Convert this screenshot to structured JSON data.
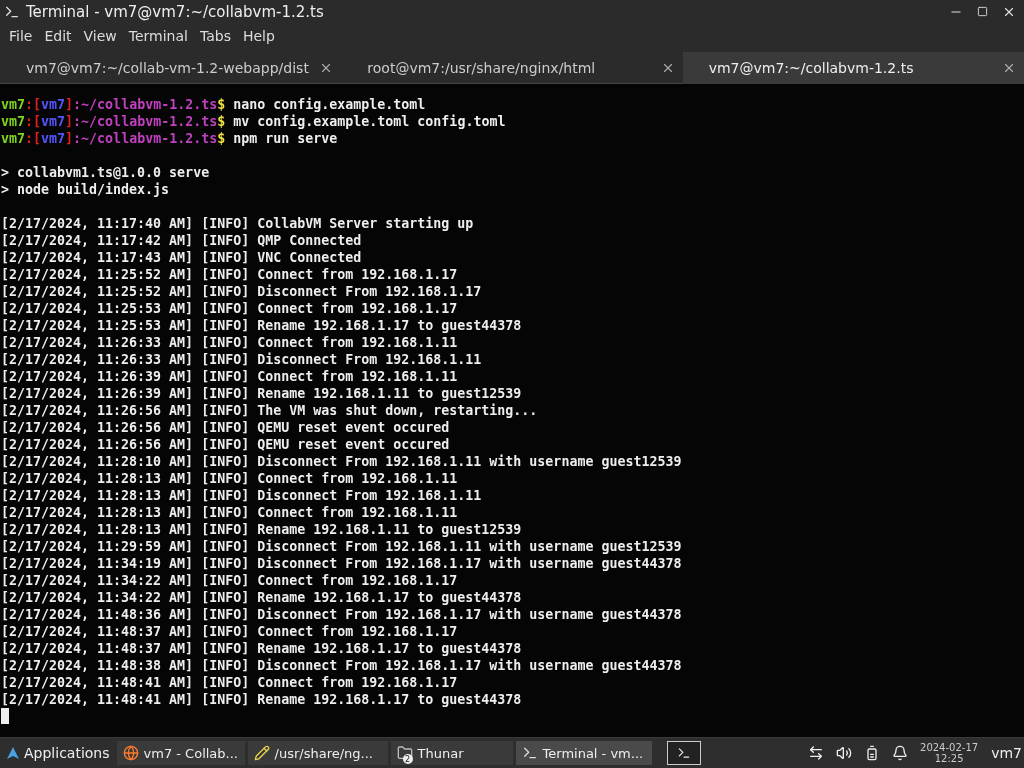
{
  "window": {
    "title": "Terminal - vm7@vm7:~/collabvm-1.2.ts"
  },
  "menu": [
    "File",
    "Edit",
    "View",
    "Terminal",
    "Tabs",
    "Help"
  ],
  "tabs": [
    {
      "label": "vm7@vm7:~/collab-vm-1.2-webapp/dist",
      "selected": false
    },
    {
      "label": "root@vm7:/usr/share/nginx/html",
      "selected": false
    },
    {
      "label": "vm7@vm7:~/collabvm-1.2.ts",
      "selected": true
    }
  ],
  "terminal": {
    "prompts": [
      {
        "segments": [
          {
            "text": "vm7",
            "color": "#7fd321"
          },
          {
            "text": ":[",
            "color": "#e02020"
          },
          {
            "text": "vm7",
            "color": "#5555ff"
          },
          {
            "text": "]",
            "color": "#e02020"
          },
          {
            "text": ":~/collabvm-1.2.ts",
            "color": "#c040c0"
          },
          {
            "text": "$",
            "color": "#f0e040"
          },
          {
            "text": " nano config.example.toml",
            "color": "#eeeeee"
          }
        ]
      },
      {
        "segments": [
          {
            "text": "vm7",
            "color": "#7fd321"
          },
          {
            "text": ":[",
            "color": "#e02020"
          },
          {
            "text": "vm7",
            "color": "#5555ff"
          },
          {
            "text": "]",
            "color": "#e02020"
          },
          {
            "text": ":~/collabvm-1.2.ts",
            "color": "#c040c0"
          },
          {
            "text": "$",
            "color": "#f0e040"
          },
          {
            "text": " mv config.example.toml config.toml",
            "color": "#eeeeee"
          }
        ]
      },
      {
        "segments": [
          {
            "text": "vm7",
            "color": "#7fd321"
          },
          {
            "text": ":[",
            "color": "#e02020"
          },
          {
            "text": "vm7",
            "color": "#5555ff"
          },
          {
            "text": "]",
            "color": "#e02020"
          },
          {
            "text": ":~/collabvm-1.2.ts",
            "color": "#c040c0"
          },
          {
            "text": "$",
            "color": "#f0e040"
          },
          {
            "text": " npm run serve",
            "color": "#eeeeee"
          }
        ]
      }
    ],
    "npm_output": [
      "> collabvm1.ts@1.0.0 serve",
      "> node build/index.js"
    ],
    "log": [
      "[2/17/2024, 11:17:40 AM] [INFO] CollabVM Server starting up",
      "[2/17/2024, 11:17:42 AM] [INFO] QMP Connected",
      "[2/17/2024, 11:17:43 AM] [INFO] VNC Connected",
      "[2/17/2024, 11:25:52 AM] [INFO] Connect from 192.168.1.17",
      "[2/17/2024, 11:25:52 AM] [INFO] Disconnect From 192.168.1.17",
      "[2/17/2024, 11:25:53 AM] [INFO] Connect from 192.168.1.17",
      "[2/17/2024, 11:25:53 AM] [INFO] Rename 192.168.1.17 to guest44378",
      "[2/17/2024, 11:26:33 AM] [INFO] Connect from 192.168.1.11",
      "[2/17/2024, 11:26:33 AM] [INFO] Disconnect From 192.168.1.11",
      "[2/17/2024, 11:26:39 AM] [INFO] Connect from 192.168.1.11",
      "[2/17/2024, 11:26:39 AM] [INFO] Rename 192.168.1.11 to guest12539",
      "[2/17/2024, 11:26:56 AM] [INFO] The VM was shut down, restarting...",
      "[2/17/2024, 11:26:56 AM] [INFO] QEMU reset event occured",
      "[2/17/2024, 11:26:56 AM] [INFO] QEMU reset event occured",
      "[2/17/2024, 11:28:10 AM] [INFO] Disconnect From 192.168.1.11 with username guest12539",
      "[2/17/2024, 11:28:13 AM] [INFO] Connect from 192.168.1.11",
      "[2/17/2024, 11:28:13 AM] [INFO] Disconnect From 192.168.1.11",
      "[2/17/2024, 11:28:13 AM] [INFO] Connect from 192.168.1.11",
      "[2/17/2024, 11:28:13 AM] [INFO] Rename 192.168.1.11 to guest12539",
      "[2/17/2024, 11:29:59 AM] [INFO] Disconnect From 192.168.1.11 with username guest12539",
      "[2/17/2024, 11:34:19 AM] [INFO] Disconnect From 192.168.1.17 with username guest44378",
      "[2/17/2024, 11:34:22 AM] [INFO] Connect from 192.168.1.17",
      "[2/17/2024, 11:34:22 AM] [INFO] Rename 192.168.1.17 to guest44378",
      "[2/17/2024, 11:48:36 AM] [INFO] Disconnect From 192.168.1.17 with username guest44378",
      "[2/17/2024, 11:48:37 AM] [INFO] Connect from 192.168.1.17",
      "[2/17/2024, 11:48:37 AM] [INFO] Rename 192.168.1.17 to guest44378",
      "[2/17/2024, 11:48:38 AM] [INFO] Disconnect From 192.168.1.17 with username guest44378",
      "[2/17/2024, 11:48:41 AM] [INFO] Connect from 192.168.1.17",
      "[2/17/2024, 11:48:41 AM] [INFO] Rename 192.168.1.17 to guest44378"
    ]
  },
  "taskbar": {
    "start": "Applications",
    "tasks": [
      {
        "kind": "browser",
        "label": "vm7 - Collab...",
        "selected": false
      },
      {
        "kind": "editor",
        "label": "/usr/share/ng...",
        "selected": false
      },
      {
        "kind": "folder",
        "label": "Thunar",
        "badge": "2",
        "selected": false
      },
      {
        "kind": "terminal",
        "label": "Terminal - vm...",
        "selected": true
      }
    ],
    "date": "2024-02-17",
    "time": "12:25",
    "user": "vm7"
  }
}
